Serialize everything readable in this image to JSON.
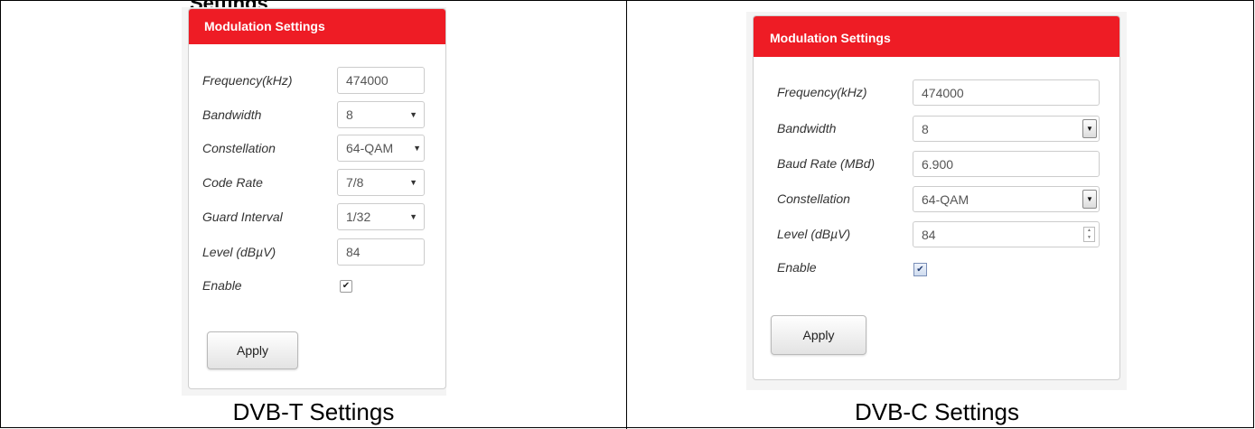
{
  "page": {
    "clipped_heading": "Settings"
  },
  "dvbt": {
    "panel_title": "Modulation Settings",
    "frequency_label": "Frequency(kHz)",
    "frequency_value": "474000",
    "bandwidth_label": "Bandwidth",
    "bandwidth_value": "8",
    "constellation_label": "Constellation",
    "constellation_value": "64-QAM",
    "code_rate_label": "Code Rate",
    "code_rate_value": "7/8",
    "guard_label": "Guard Interval",
    "guard_value": "1/32",
    "level_label": "Level (dBµV)",
    "level_value": "84",
    "enable_label": "Enable",
    "enable_checked": true,
    "apply_label": "Apply",
    "caption": "DVB-T Settings"
  },
  "dvbc": {
    "panel_title": "Modulation Settings",
    "frequency_label": "Frequency(kHz)",
    "frequency_value": "474000",
    "bandwidth_label": "Bandwidth",
    "bandwidth_value": "8",
    "baud_label": "Baud Rate (MBd)",
    "baud_value": "6.900",
    "constellation_label": "Constellation",
    "constellation_value": "64-QAM",
    "level_label": "Level (dBµV)",
    "level_value": "84",
    "enable_label": "Enable",
    "enable_checked": true,
    "apply_label": "Apply",
    "caption": "DVB-C Settings"
  },
  "colors": {
    "header_red": "#ee1c25",
    "header_text": "#ffffff"
  },
  "icons": {
    "dropdown": "chevron-down-icon",
    "checkmark": "checkmark-icon",
    "spinner": "spinner-icon"
  }
}
